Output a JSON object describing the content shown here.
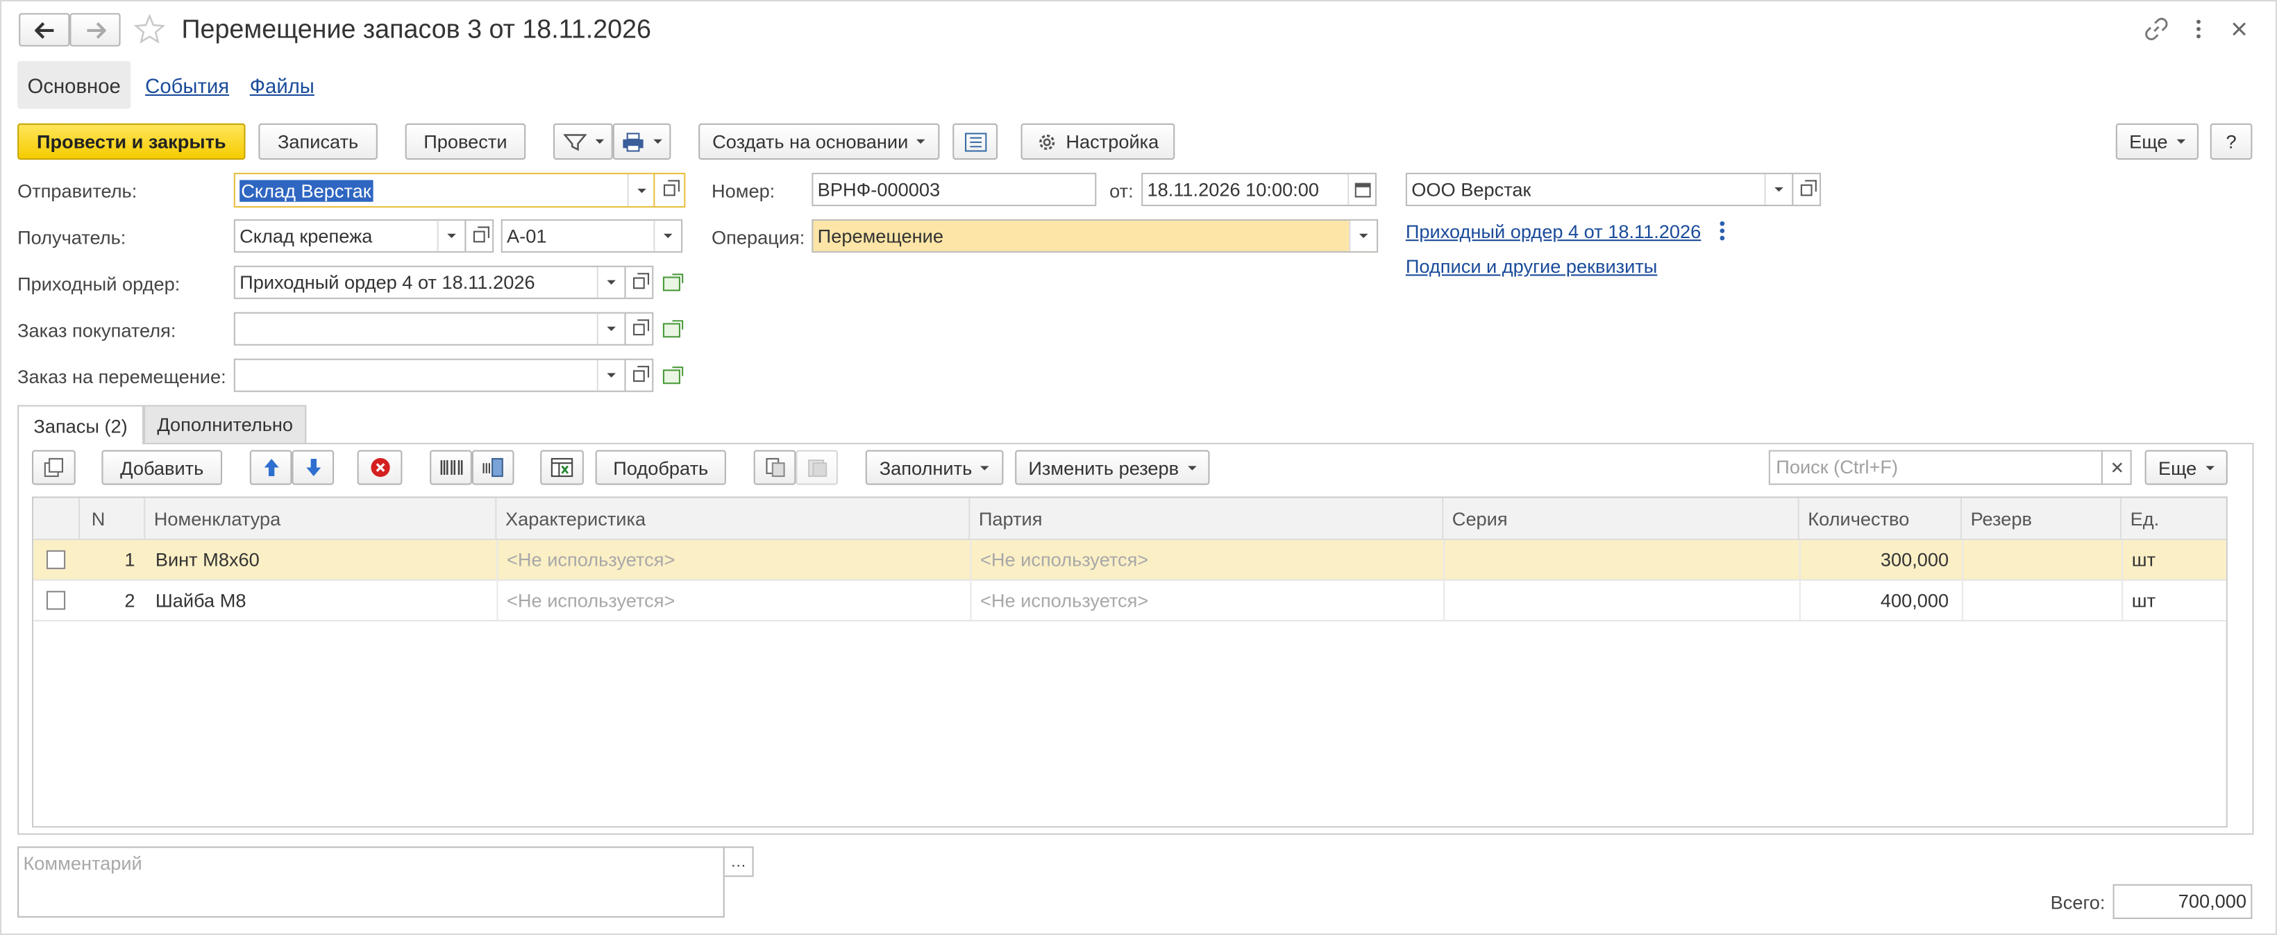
{
  "header": {
    "title": "Перемещение запасов 3 от 18.11.2026"
  },
  "nav_tabs": [
    "Основное",
    "События",
    "Файлы"
  ],
  "toolbar": {
    "post_close": "Провести и закрыть",
    "save": "Записать",
    "post": "Провести",
    "create_based": "Создать на основании",
    "settings": "Настройка",
    "more": "Еще",
    "help": "?"
  },
  "form": {
    "sender_label": "Отправитель:",
    "sender": "Склад Верстак",
    "recipient_label": "Получатель:",
    "recipient": "Склад крепежа",
    "cell": "А-01",
    "receipt_label": "Приходный ордер:",
    "receipt": "Приходный ордер 4 от 18.11.2026",
    "customer_order_label": "Заказ покупателя:",
    "customer_order": "",
    "move_order_label": "Заказ на перемещение:",
    "move_order": "",
    "number_label": "Номер:",
    "number": "ВРНФ-000003",
    "date_label": "от:",
    "date": "18.11.2026 10:00:00",
    "operation_label": "Операция:",
    "operation": "Перемещение",
    "org": "ООО Верстак",
    "link_receipt": "Приходный ордер 4 от 18.11.2026",
    "link_signatures": "Подписи и другие реквизиты"
  },
  "inner_tabs": [
    "Запасы (2)",
    "Дополнительно"
  ],
  "table_toolbar": {
    "add": "Добавить",
    "pick": "Подобрать",
    "fill": "Заполнить",
    "change_reserve": "Изменить резерв",
    "search_placeholder": "Поиск (Ctrl+F)",
    "more": "Еще"
  },
  "table": {
    "columns": [
      "N",
      "Номенклатура",
      "Характеристика",
      "Партия",
      "Серия",
      "Количество",
      "Резерв",
      "Ед."
    ],
    "rows": [
      {
        "n": "1",
        "item": "Винт М8х60",
        "char": "<Не используется>",
        "batch": "<Не используется>",
        "series": "",
        "qty": "300,000",
        "reserve": "",
        "unit": "шт"
      },
      {
        "n": "2",
        "item": "Шайба М8",
        "char": "<Не используется>",
        "batch": "<Не используется>",
        "series": "",
        "qty": "400,000",
        "reserve": "",
        "unit": "шт"
      }
    ]
  },
  "footer": {
    "comment_placeholder": "Комментарий",
    "total_label": "Всего:",
    "total": "700,000"
  },
  "colors": {
    "accent_yellow": "#f5cc00",
    "selected_row": "#fbefc6",
    "operation_bg": "#fce5a6",
    "link": "#1a4b9a"
  }
}
